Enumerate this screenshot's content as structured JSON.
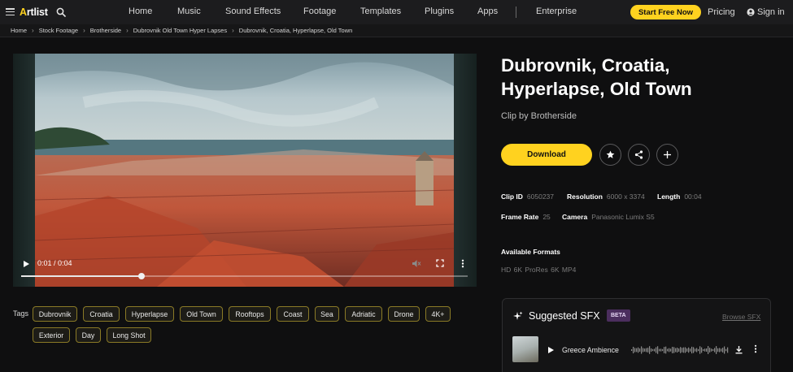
{
  "nav": {
    "brand": "Artlist",
    "links": [
      "Home",
      "Music",
      "Sound Effects",
      "Footage",
      "Templates",
      "Plugins",
      "Apps",
      "Enterprise"
    ],
    "cta": "Start Free Now",
    "pricing": "Pricing",
    "signin": "Sign in"
  },
  "breadcrumb": [
    "Home",
    "Stock Footage",
    "Brotherside",
    "Dubrovnik Old Town Hyper Lapses",
    "Dubrovnik, Croatia, Hyperlapse, Old Town"
  ],
  "player": {
    "time": "0:01 / 0:04",
    "progress": 0.27
  },
  "tags": {
    "label": "Tags",
    "items": [
      "Dubrovnik",
      "Croatia",
      "Hyperlapse",
      "Old Town",
      "Rooftops",
      "Coast",
      "Sea",
      "Adriatic",
      "Drone",
      "4K+",
      "Exterior",
      "Day",
      "Long Shot"
    ]
  },
  "clip": {
    "title_line1": "Dubrovnik, Croatia,",
    "title_line2": "Hyperlapse, Old Town",
    "byline": "Clip by Brotherside",
    "download": "Download",
    "meta": {
      "clip_id_label": "Clip ID",
      "clip_id": "6050237",
      "resolution_label": "Resolution",
      "resolution": "6000 x 3374",
      "length_label": "Length",
      "length": "00:04",
      "frame_rate_label": "Frame Rate",
      "frame_rate": "25",
      "camera_label": "Camera",
      "camera": "Panasonic Lumix S5"
    },
    "formats_title": "Available Formats",
    "formats": "HD  6K ProRes  6K MP4"
  },
  "sfx": {
    "title": "Suggested SFX",
    "badge": "BETA",
    "browse": "Browse SFX",
    "track_name": "Greece Ambience"
  },
  "colors": {
    "accent": "#ffd21f",
    "beta_bg": "#4b2e5e",
    "tag_border": "#8a7a26"
  }
}
